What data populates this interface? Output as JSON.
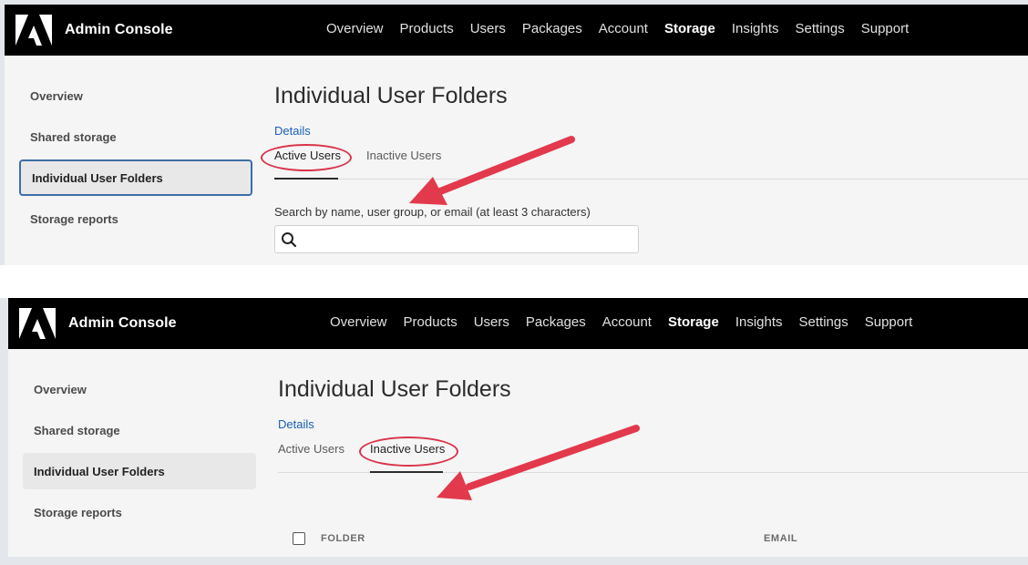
{
  "app": {
    "title": "Admin Console"
  },
  "nav": [
    "Overview",
    "Products",
    "Users",
    "Packages",
    "Account",
    "Storage",
    "Insights",
    "Settings",
    "Support"
  ],
  "sidebar": [
    "Overview",
    "Shared storage",
    "Individual User Folders",
    "Storage reports"
  ],
  "page": {
    "title": "Individual User Folders",
    "details_link": "Details"
  },
  "tabs": {
    "active": "Active Users",
    "inactive": "Inactive Users"
  },
  "search": {
    "label": "Search by name, user group, or email (at least 3 characters)",
    "value": ""
  },
  "table": {
    "col_folder": "FOLDER",
    "col_email": "EMAIL"
  },
  "colors": {
    "accent_link": "#1b5fb5",
    "annotation_red": "#d9344a",
    "topbar": "#000000"
  },
  "icons": [
    "adobe-logo-icon",
    "search-icon",
    "annotation-arrow",
    "annotation-circle"
  ]
}
